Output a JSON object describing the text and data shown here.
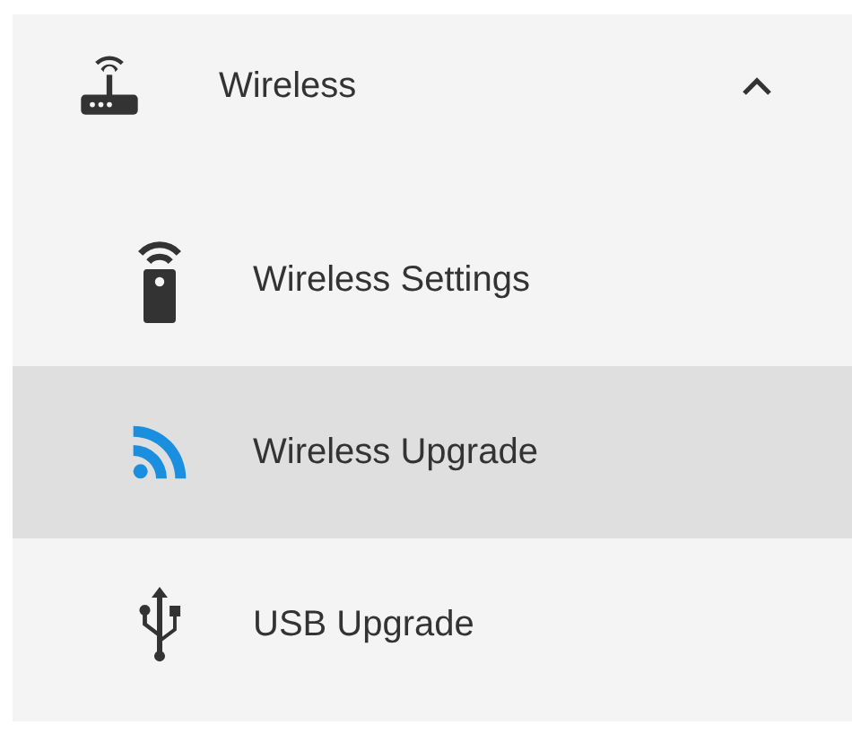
{
  "menu": {
    "label": "Wireless",
    "expanded": true,
    "items": [
      {
        "label": "Wireless Settings",
        "kind": "remote",
        "selected": false
      },
      {
        "label": "Wireless Upgrade",
        "kind": "feed",
        "selected": true
      },
      {
        "label": "USB Upgrade",
        "kind": "usb",
        "selected": false
      }
    ]
  }
}
